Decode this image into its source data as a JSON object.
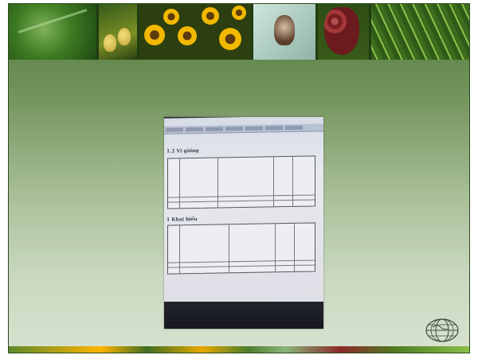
{
  "slide": {
    "banner": {
      "images": [
        "leaf-image",
        "pear-image",
        "sunflower-image",
        "fly-image",
        "berries-image",
        "grass-image"
      ]
    },
    "photo": {
      "description_hidden": true,
      "screen": {
        "section1_title": "1.2 Ví giống",
        "section2_title": "1 Khai biểu"
      }
    },
    "logo": {
      "icon": "globe-logo-icon"
    },
    "colors": {
      "frame_top": "#4f7a3c",
      "frame_bottom": "#d8e2d0",
      "banner_bg": "#1f3d12"
    }
  }
}
